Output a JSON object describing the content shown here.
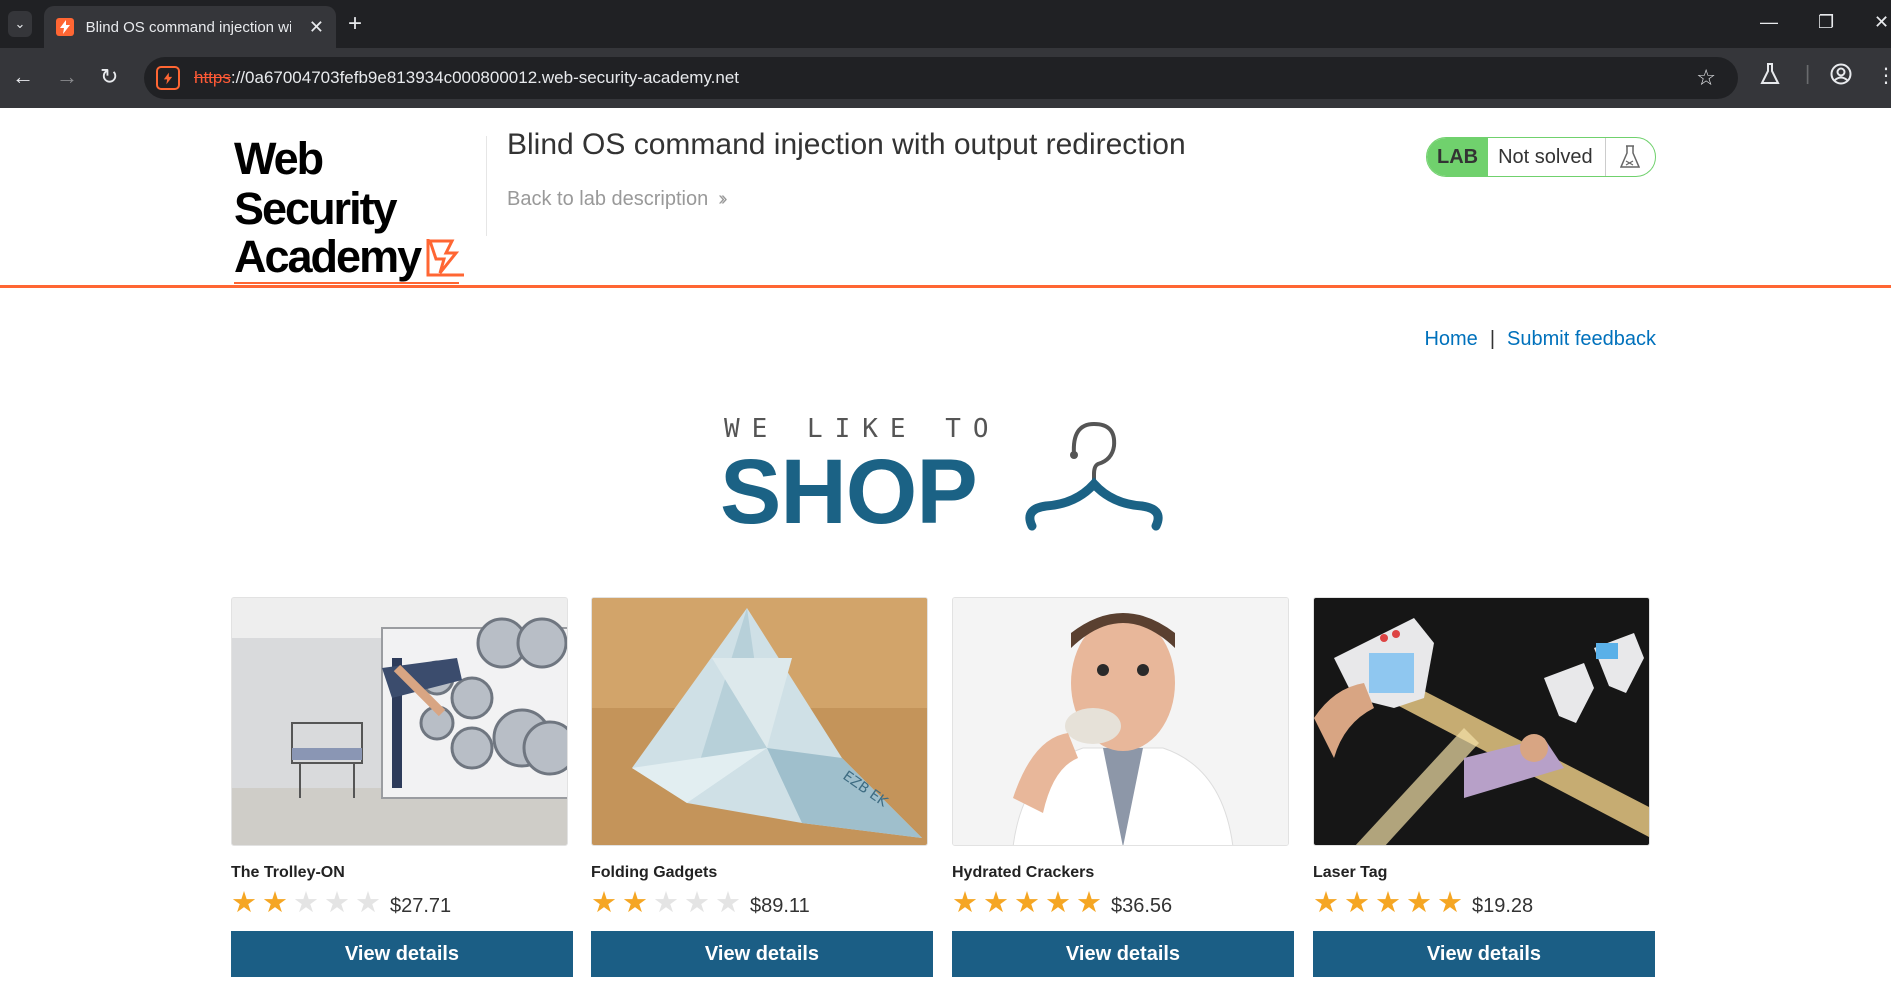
{
  "browser": {
    "tab_title": "Blind OS command injection wi",
    "url_scheme": "https",
    "url_rest": "://0a67004703fefb9e813934c000800012.web-security-academy.net"
  },
  "header": {
    "logo_line1": "Web Security",
    "logo_line2": "Academy",
    "lab_title": "Blind OS command injection with output redirection",
    "back_link": "Back to lab description",
    "lab_badge": "LAB",
    "lab_status": "Not solved"
  },
  "nav": {
    "home": "Home",
    "separator": "|",
    "feedback": "Submit feedback"
  },
  "banner": {
    "small": "WE LIKE TO",
    "big": "SHOP"
  },
  "products": [
    {
      "name": "The Trolley-ON",
      "rating": 2,
      "price": "$27.71",
      "button": "View details"
    },
    {
      "name": "Folding Gadgets",
      "rating": 2,
      "price": "$89.11",
      "button": "View details"
    },
    {
      "name": "Hydrated Crackers",
      "rating": 5,
      "price": "$36.56",
      "button": "View details"
    },
    {
      "name": "Laser Tag",
      "rating": 5,
      "price": "$19.28",
      "button": "View details"
    }
  ],
  "colors": {
    "accent_orange": "#ff6633",
    "shop_blue": "#1b6285",
    "button_blue": "#1b5e85",
    "link_blue": "#0071bc",
    "lab_green": "#70d16d",
    "star_gold": "#f5a623"
  }
}
